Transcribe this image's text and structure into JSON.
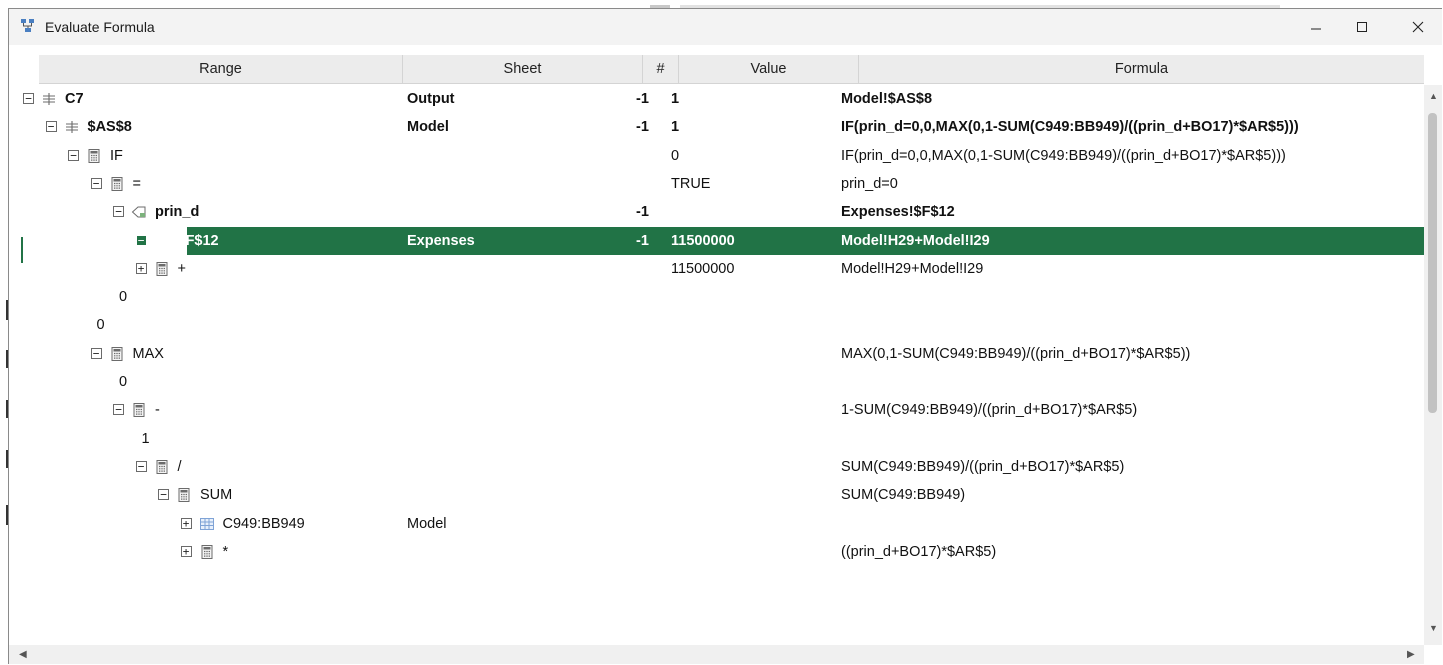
{
  "window": {
    "title": "Evaluate Formula"
  },
  "columns": {
    "range": "Range",
    "sheet": "Sheet",
    "num": "#",
    "value": "Value",
    "formula": "Formula"
  },
  "rows": [
    {
      "name": "C7",
      "sheet": "Output",
      "num": "-1",
      "value": "1",
      "formula": "Model!$AS$8",
      "bold": true,
      "expander": "minus",
      "icon": "cell-reference-icon"
    },
    {
      "name": "$AS$8",
      "sheet": "Model",
      "num": "-1",
      "value": "1",
      "formula": "IF(prin_d=0,0,MAX(0,1-SUM(C949:BB949)/((prin_d+BO17)*$AR$5)))",
      "bold": true,
      "expander": "minus",
      "icon": "cell-reference-icon"
    },
    {
      "name": "IF",
      "sheet": "",
      "num": "",
      "value": "0",
      "formula": "IF(prin_d=0,0,MAX(0,1-SUM(C949:BB949)/((prin_d+BO17)*$AR$5)))",
      "bold": false,
      "expander": "minus",
      "icon": "function-icon"
    },
    {
      "name": "=",
      "sheet": "",
      "num": "",
      "value": "TRUE",
      "formula": "prin_d=0",
      "bold": false,
      "expander": "minus",
      "icon": "function-icon"
    },
    {
      "name": "prin_d",
      "sheet": "",
      "num": "-1",
      "value": "",
      "formula": "Expenses!$F$12",
      "bold": true,
      "expander": "minus",
      "icon": "named-range-icon"
    },
    {
      "name": "$F$12",
      "sheet": "Expenses",
      "num": "-1",
      "value": "11500000",
      "formula": "Model!H29+Model!I29",
      "bold": true,
      "expander": "minus",
      "icon": "cell-icon",
      "selected": true
    },
    {
      "name": "+",
      "sheet": "",
      "num": "",
      "value": "11500000",
      "formula": "Model!H29+Model!I29",
      "bold": false,
      "expander": "plus",
      "icon": "function-icon"
    },
    {
      "name": "0",
      "sheet": "",
      "num": "",
      "value": "",
      "formula": "",
      "bold": false,
      "expander": "none",
      "icon": ""
    },
    {
      "name": "0",
      "sheet": "",
      "num": "",
      "value": "",
      "formula": "",
      "bold": false,
      "expander": "none",
      "icon": ""
    },
    {
      "name": "MAX",
      "sheet": "",
      "num": "",
      "value": "",
      "formula": "MAX(0,1-SUM(C949:BB949)/((prin_d+BO17)*$AR$5))",
      "bold": false,
      "expander": "minus",
      "icon": "function-icon"
    },
    {
      "name": "0",
      "sheet": "",
      "num": "",
      "value": "",
      "formula": "",
      "bold": false,
      "expander": "none",
      "icon": ""
    },
    {
      "name": "-",
      "sheet": "",
      "num": "",
      "value": "",
      "formula": "1-SUM(C949:BB949)/((prin_d+BO17)*$AR$5)",
      "bold": false,
      "expander": "minus",
      "icon": "function-icon"
    },
    {
      "name": "1",
      "sheet": "",
      "num": "",
      "value": "",
      "formula": "",
      "bold": false,
      "expander": "none",
      "icon": ""
    },
    {
      "name": "/",
      "sheet": "",
      "num": "",
      "value": "",
      "formula": "SUM(C949:BB949)/((prin_d+BO17)*$AR$5)",
      "bold": false,
      "expander": "minus",
      "icon": "function-icon"
    },
    {
      "name": "SUM",
      "sheet": "",
      "num": "",
      "value": "",
      "formula": "SUM(C949:BB949)",
      "bold": false,
      "expander": "minus",
      "icon": "function-icon"
    },
    {
      "name": "C949:BB949",
      "sheet": "Model",
      "num": "",
      "value": "",
      "formula": "",
      "bold": false,
      "expander": "plus",
      "icon": "range-icon"
    },
    {
      "name": "*",
      "sheet": "",
      "num": "",
      "value": "",
      "formula": "((prin_d+BO17)*$AR$5)",
      "bold": false,
      "expander": "plus",
      "icon": "function-icon"
    }
  ]
}
